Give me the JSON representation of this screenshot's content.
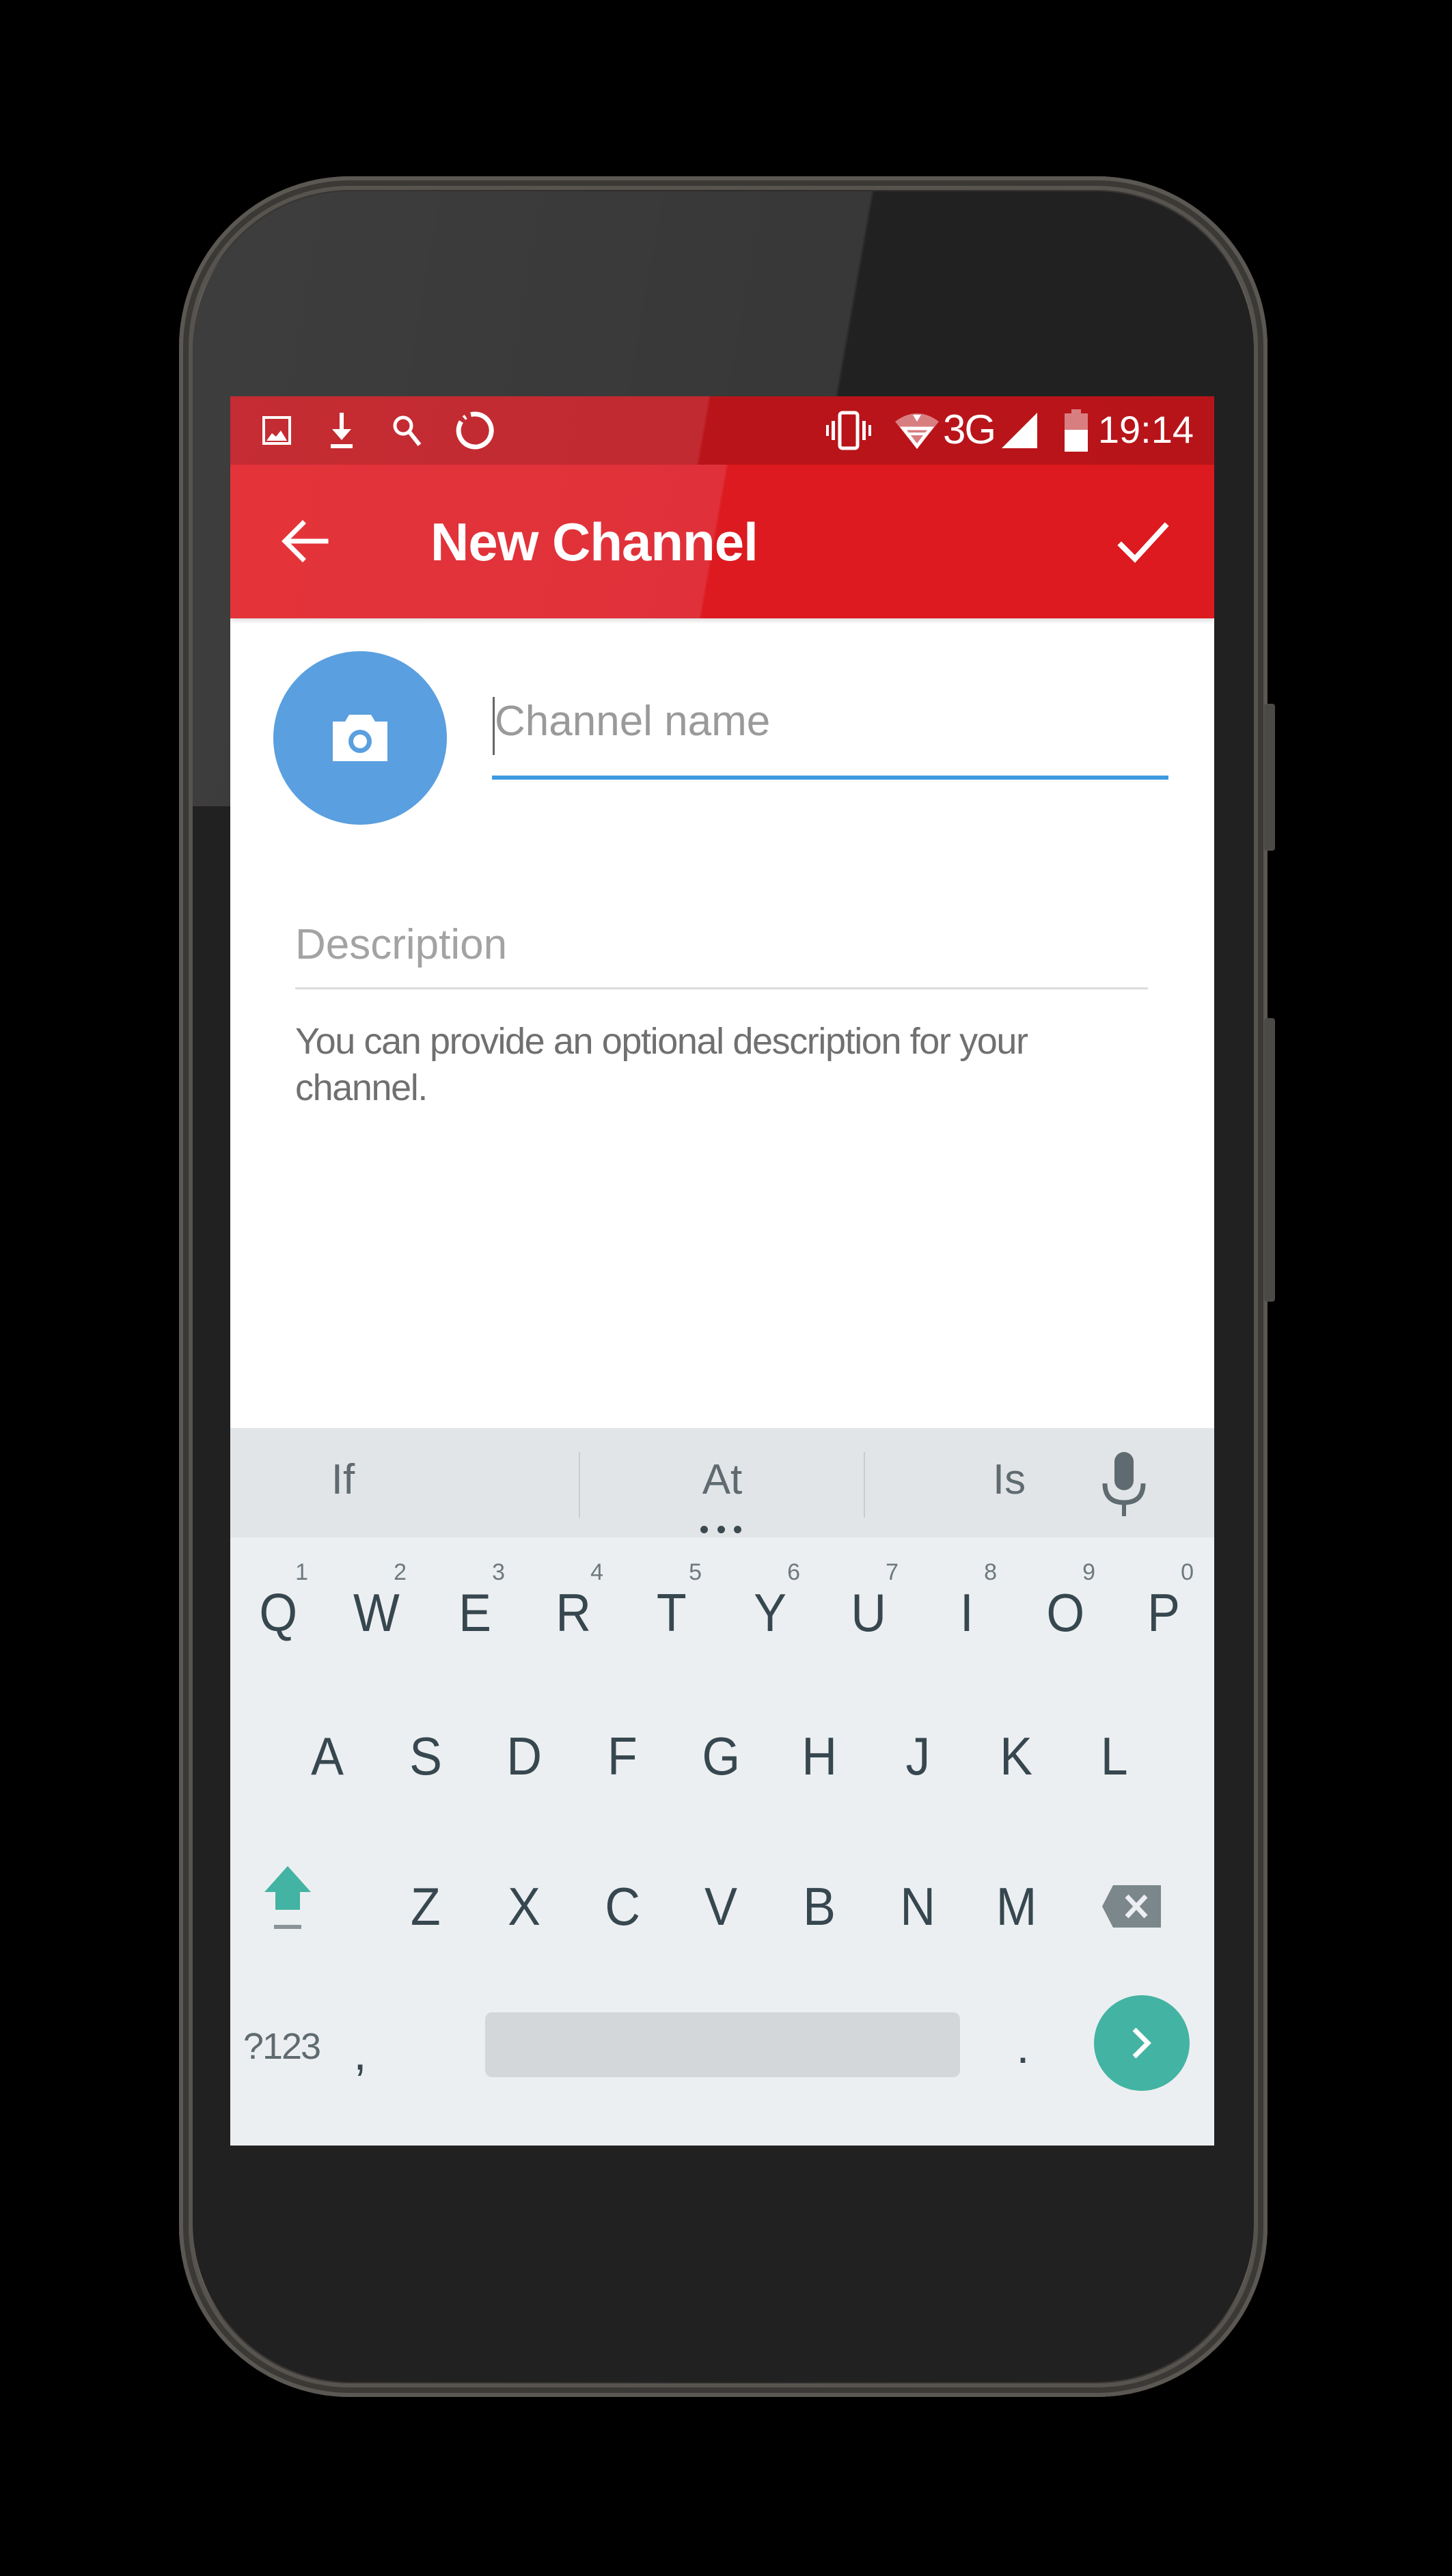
{
  "status_bar": {
    "left_icons": [
      "image-icon",
      "download-icon",
      "search-icon",
      "sync-icon"
    ],
    "right_icons": [
      "vibrate-icon",
      "wifi-icon",
      "signal-icon",
      "battery-icon"
    ],
    "network_type": "3G",
    "time": "19:14",
    "color": "#c12a31"
  },
  "app_bar": {
    "title": "New Channel",
    "back_icon": "arrow-left-icon",
    "done_icon": "check-icon",
    "color": "#dc1a1f"
  },
  "form": {
    "avatar_icon": "camera-icon",
    "avatar_color": "#5a9fdf",
    "channel_name": {
      "value": "",
      "placeholder": "Channel name",
      "focused": true,
      "underline_color": "#3d9ae0"
    },
    "description": {
      "value": "",
      "placeholder": "Description"
    },
    "helper_text": "You can provide an optional description for your channel."
  },
  "keyboard": {
    "suggestions": [
      "If",
      "At",
      "Is"
    ],
    "mic_icon": "microphone-icon",
    "row1": [
      {
        "key": "Q",
        "hint": "1"
      },
      {
        "key": "W",
        "hint": "2"
      },
      {
        "key": "E",
        "hint": "3"
      },
      {
        "key": "R",
        "hint": "4"
      },
      {
        "key": "T",
        "hint": "5"
      },
      {
        "key": "Y",
        "hint": "6"
      },
      {
        "key": "U",
        "hint": "7"
      },
      {
        "key": "I",
        "hint": "8"
      },
      {
        "key": "O",
        "hint": "9"
      },
      {
        "key": "P",
        "hint": "0"
      }
    ],
    "row2": [
      "A",
      "S",
      "D",
      "F",
      "G",
      "H",
      "J",
      "K",
      "L"
    ],
    "row3": [
      "Z",
      "X",
      "C",
      "V",
      "B",
      "N",
      "M"
    ],
    "shift_icon": "shift-icon",
    "backspace_icon": "backspace-icon",
    "symbols_label": "?123",
    "comma_label": ",",
    "period_label": ".",
    "enter_icon": "chevron-right-icon",
    "accent_color": "#43b3a3"
  }
}
